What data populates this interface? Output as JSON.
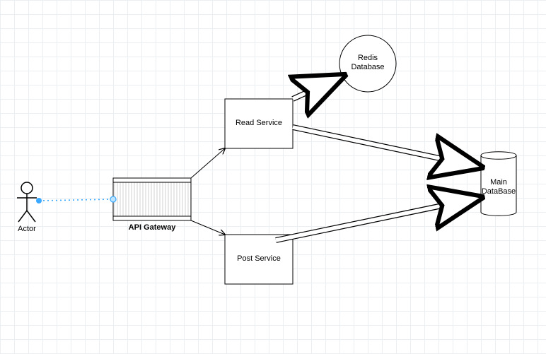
{
  "nodes": {
    "actor": {
      "label": "Actor"
    },
    "api_gateway": {
      "label": "API Gateway"
    },
    "read_svc": {
      "label": "Read Service"
    },
    "post_svc": {
      "label": "Post Service"
    },
    "redis": {
      "label_line1": "Redis",
      "label_line2": "Database"
    },
    "main_db": {
      "label_line1": "Main",
      "label_line2": "DataBase"
    }
  }
}
